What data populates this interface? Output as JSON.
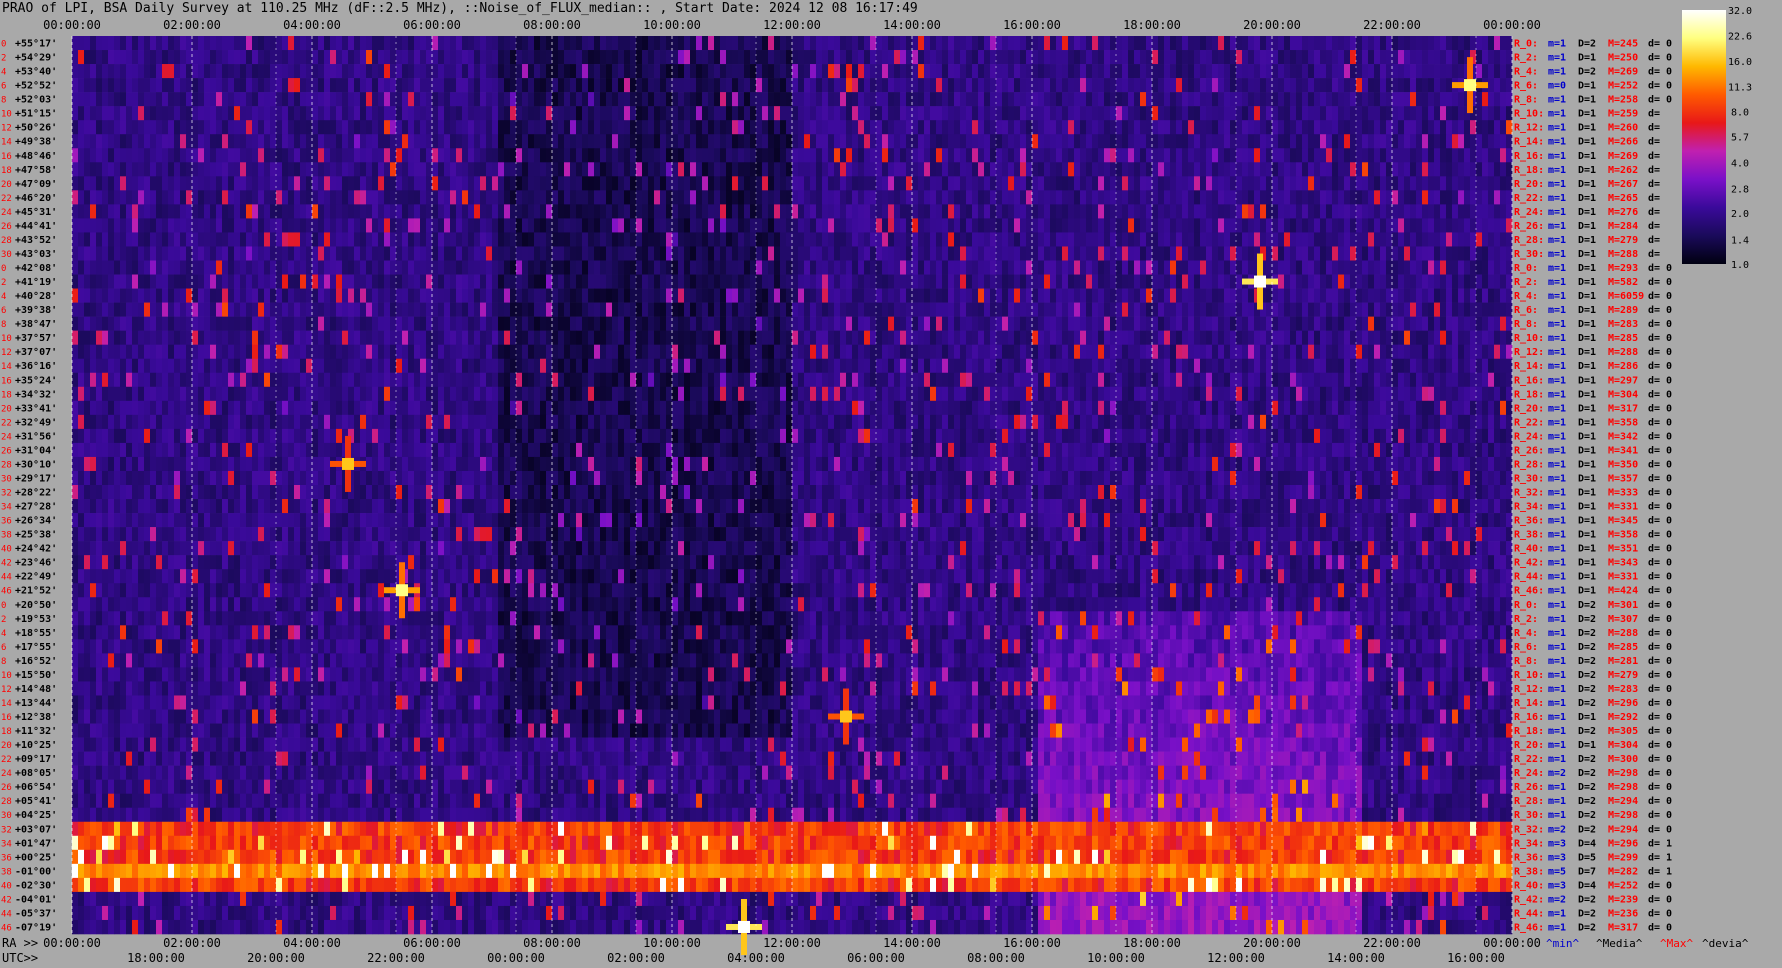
{
  "chart_data": {
    "type": "heatmap",
    "title": "PRAO of LPI, BSA Daily Survey at 110.25 MHz (dF::2.5 MHz), ::Noise_of_FLUX_median:: , Start Date: 2024 12 08 16:17:49",
    "top_time_ticks": [
      "00:00:00",
      "02:00:00",
      "04:00:00",
      "06:00:00",
      "08:00:00",
      "10:00:00",
      "12:00:00",
      "14:00:00",
      "16:00:00",
      "18:00:00",
      "20:00:00",
      "22:00:00",
      "00:00:00"
    ],
    "ra_label": "RA >>",
    "ra_ticks": [
      "00:00:00",
      "02:00:00",
      "04:00:00",
      "06:00:00",
      "08:00:00",
      "10:00:00",
      "12:00:00",
      "14:00:00",
      "16:00:00",
      "18:00:00",
      "20:00:00",
      "22:00:00",
      "00:00:00"
    ],
    "utc_label": "UTC>>",
    "utc_ticks": [
      "18:00:00",
      "20:00:00",
      "22:00:00",
      "00:00:00",
      "02:00:00",
      "04:00:00",
      "06:00:00",
      "08:00:00",
      "10:00:00",
      "12:00:00",
      "14:00:00",
      "16:00:00"
    ],
    "declinations": [
      "+55°17'",
      "+54°29'",
      "+53°40'",
      "+52°52'",
      "+52°03'",
      "+51°15'",
      "+50°26'",
      "+49°38'",
      "+48°46'",
      "+47°58'",
      "+47°09'",
      "+46°20'",
      "+45°31'",
      "+44°41'",
      "+43°52'",
      "+43°03'",
      "+42°08'",
      "+41°19'",
      "+40°28'",
      "+39°38'",
      "+38°47'",
      "+37°57'",
      "+37°07'",
      "+36°16'",
      "+35°24'",
      "+34°32'",
      "+33°41'",
      "+32°49'",
      "+31°56'",
      "+31°04'",
      "+30°10'",
      "+29°17'",
      "+28°22'",
      "+27°28'",
      "+26°34'",
      "+25°38'",
      "+24°42'",
      "+23°46'",
      "+22°49'",
      "+21°52'",
      "+20°50'",
      "+19°53'",
      "+18°55'",
      "+17°55'",
      "+16°52'",
      "+15°50'",
      "+14°48'",
      "+13°44'",
      "+12°38'",
      "+11°32'",
      "+10°25'",
      "+09°17'",
      "+08°05'",
      "+06°54'",
      "+05°41'",
      "+04°25'",
      "+03°07'",
      "+01°47'",
      "+00°25'",
      "-01°00'",
      "-02°30'",
      "-04°01'",
      "-05°37'",
      "-07°19'"
    ],
    "row_index": [
      "0",
      "2",
      "4",
      "6",
      "8",
      "10",
      "12",
      "14",
      "16",
      "18",
      "20",
      "22",
      "24",
      "26",
      "28",
      "30",
      "0",
      "2",
      "4",
      "6",
      "8",
      "10",
      "12",
      "14",
      "16",
      "18",
      "20",
      "22",
      "24",
      "26",
      "28",
      "30",
      "32",
      "34",
      "36",
      "38",
      "40",
      "42",
      "44",
      "46",
      "0",
      "2",
      "4",
      "6",
      "8",
      "10",
      "12",
      "14",
      "16",
      "18",
      "20",
      "22",
      "24",
      "26",
      "28",
      "30",
      "32",
      "34",
      "36",
      "38",
      "40",
      "42",
      "44",
      "46"
    ],
    "stats": [
      {
        "r": "R_0:",
        "m": "m=1",
        "d": "D=2",
        "mx": "M=245",
        "dv": "d= 0"
      },
      {
        "r": "R_2:",
        "m": "m=1",
        "d": "D=1",
        "mx": "M=250",
        "dv": "d= 0"
      },
      {
        "r": "R_4:",
        "m": "m=1",
        "d": "D=2",
        "mx": "M=269",
        "dv": "d= 0"
      },
      {
        "r": "R_6:",
        "m": "m=0",
        "d": "D=1",
        "mx": "M=252",
        "dv": "d= 0"
      },
      {
        "r": "R_8:",
        "m": "m=1",
        "d": "D=1",
        "mx": "M=258",
        "dv": "d= 0"
      },
      {
        "r": "R_10:",
        "m": "m=1",
        "d": "D=1",
        "mx": "M=259",
        "dv": "d="
      },
      {
        "r": "R_12:",
        "m": "m=1",
        "d": "D=1",
        "mx": "M=260",
        "dv": "d="
      },
      {
        "r": "R_14:",
        "m": "m=1",
        "d": "D=1",
        "mx": "M=266",
        "dv": "d="
      },
      {
        "r": "R_16:",
        "m": "m=1",
        "d": "D=1",
        "mx": "M=269",
        "dv": "d="
      },
      {
        "r": "R_18:",
        "m": "m=1",
        "d": "D=1",
        "mx": "M=262",
        "dv": "d="
      },
      {
        "r": "R_20:",
        "m": "m=1",
        "d": "D=1",
        "mx": "M=267",
        "dv": "d="
      },
      {
        "r": "R_22:",
        "m": "m=1",
        "d": "D=1",
        "mx": "M=265",
        "dv": "d="
      },
      {
        "r": "R_24:",
        "m": "m=1",
        "d": "D=1",
        "mx": "M=276",
        "dv": "d="
      },
      {
        "r": "R_26:",
        "m": "m=1",
        "d": "D=1",
        "mx": "M=284",
        "dv": "d="
      },
      {
        "r": "R_28:",
        "m": "m=1",
        "d": "D=1",
        "mx": "M=279",
        "dv": "d="
      },
      {
        "r": "R_30:",
        "m": "m=1",
        "d": "D=1",
        "mx": "M=288",
        "dv": "d="
      },
      {
        "r": "R_0:",
        "m": "m=1",
        "d": "D=1",
        "mx": "M=293",
        "dv": "d= 0"
      },
      {
        "r": "R_2:",
        "m": "m=1",
        "d": "D=1",
        "mx": "M=582",
        "dv": "d= 0"
      },
      {
        "r": "R_4:",
        "m": "m=1",
        "d": "D=1",
        "mx": "M=6059",
        "dv": "d= 0"
      },
      {
        "r": "R_6:",
        "m": "m=1",
        "d": "D=1",
        "mx": "M=289",
        "dv": "d= 0"
      },
      {
        "r": "R_8:",
        "m": "m=1",
        "d": "D=1",
        "mx": "M=283",
        "dv": "d= 0"
      },
      {
        "r": "R_10:",
        "m": "m=1",
        "d": "D=1",
        "mx": "M=285",
        "dv": "d= 0"
      },
      {
        "r": "R_12:",
        "m": "m=1",
        "d": "D=1",
        "mx": "M=288",
        "dv": "d= 0"
      },
      {
        "r": "R_14:",
        "m": "m=1",
        "d": "D=1",
        "mx": "M=286",
        "dv": "d= 0"
      },
      {
        "r": "R_16:",
        "m": "m=1",
        "d": "D=1",
        "mx": "M=297",
        "dv": "d= 0"
      },
      {
        "r": "R_18:",
        "m": "m=1",
        "d": "D=1",
        "mx": "M=304",
        "dv": "d= 0"
      },
      {
        "r": "R_20:",
        "m": "m=1",
        "d": "D=1",
        "mx": "M=317",
        "dv": "d= 0"
      },
      {
        "r": "R_22:",
        "m": "m=1",
        "d": "D=1",
        "mx": "M=358",
        "dv": "d= 0"
      },
      {
        "r": "R_24:",
        "m": "m=1",
        "d": "D=1",
        "mx": "M=342",
        "dv": "d= 0"
      },
      {
        "r": "R_26:",
        "m": "m=1",
        "d": "D=1",
        "mx": "M=341",
        "dv": "d= 0"
      },
      {
        "r": "R_28:",
        "m": "m=1",
        "d": "D=1",
        "mx": "M=350",
        "dv": "d= 0"
      },
      {
        "r": "R_30:",
        "m": "m=1",
        "d": "D=1",
        "mx": "M=357",
        "dv": "d= 0"
      },
      {
        "r": "R_32:",
        "m": "m=1",
        "d": "D=1",
        "mx": "M=333",
        "dv": "d= 0"
      },
      {
        "r": "R_34:",
        "m": "m=1",
        "d": "D=1",
        "mx": "M=331",
        "dv": "d= 0"
      },
      {
        "r": "R_36:",
        "m": "m=1",
        "d": "D=1",
        "mx": "M=345",
        "dv": "d= 0"
      },
      {
        "r": "R_38:",
        "m": "m=1",
        "d": "D=1",
        "mx": "M=358",
        "dv": "d= 0"
      },
      {
        "r": "R_40:",
        "m": "m=1",
        "d": "D=1",
        "mx": "M=351",
        "dv": "d= 0"
      },
      {
        "r": "R_42:",
        "m": "m=1",
        "d": "D=1",
        "mx": "M=343",
        "dv": "d= 0"
      },
      {
        "r": "R_44:",
        "m": "m=1",
        "d": "D=1",
        "mx": "M=331",
        "dv": "d= 0"
      },
      {
        "r": "R_46:",
        "m": "m=1",
        "d": "D=1",
        "mx": "M=424",
        "dv": "d= 0"
      },
      {
        "r": "R_0:",
        "m": "m=1",
        "d": "D=2",
        "mx": "M=301",
        "dv": "d= 0"
      },
      {
        "r": "R_2:",
        "m": "m=1",
        "d": "D=2",
        "mx": "M=307",
        "dv": "d= 0"
      },
      {
        "r": "R_4:",
        "m": "m=1",
        "d": "D=2",
        "mx": "M=288",
        "dv": "d= 0"
      },
      {
        "r": "R_6:",
        "m": "m=1",
        "d": "D=2",
        "mx": "M=285",
        "dv": "d= 0"
      },
      {
        "r": "R_8:",
        "m": "m=1",
        "d": "D=2",
        "mx": "M=281",
        "dv": "d= 0"
      },
      {
        "r": "R_10:",
        "m": "m=1",
        "d": "D=2",
        "mx": "M=279",
        "dv": "d= 0"
      },
      {
        "r": "R_12:",
        "m": "m=1",
        "d": "D=2",
        "mx": "M=283",
        "dv": "d= 0"
      },
      {
        "r": "R_14:",
        "m": "m=1",
        "d": "D=2",
        "mx": "M=296",
        "dv": "d= 0"
      },
      {
        "r": "R_16:",
        "m": "m=1",
        "d": "D=1",
        "mx": "M=292",
        "dv": "d= 0"
      },
      {
        "r": "R_18:",
        "m": "m=1",
        "d": "D=2",
        "mx": "M=305",
        "dv": "d= 0"
      },
      {
        "r": "R_20:",
        "m": "m=1",
        "d": "D=1",
        "mx": "M=304",
        "dv": "d= 0"
      },
      {
        "r": "R_22:",
        "m": "m=1",
        "d": "D=2",
        "mx": "M=300",
        "dv": "d= 0"
      },
      {
        "r": "R_24:",
        "m": "m=2",
        "d": "D=2",
        "mx": "M=298",
        "dv": "d= 0"
      },
      {
        "r": "R_26:",
        "m": "m=1",
        "d": "D=2",
        "mx": "M=298",
        "dv": "d= 0"
      },
      {
        "r": "R_28:",
        "m": "m=1",
        "d": "D=2",
        "mx": "M=294",
        "dv": "d= 0"
      },
      {
        "r": "R_30:",
        "m": "m=1",
        "d": "D=2",
        "mx": "M=298",
        "dv": "d= 0"
      },
      {
        "r": "R_32:",
        "m": "m=2",
        "d": "D=2",
        "mx": "M=294",
        "dv": "d= 0"
      },
      {
        "r": "R_34:",
        "m": "m=3",
        "d": "D=4",
        "mx": "M=296",
        "dv": "d= 1"
      },
      {
        "r": "R_36:",
        "m": "m=3",
        "d": "D=5",
        "mx": "M=299",
        "dv": "d= 1"
      },
      {
        "r": "R_38:",
        "m": "m=5",
        "d": "D=7",
        "mx": "M=282",
        "dv": "d= 1"
      },
      {
        "r": "R_40:",
        "m": "m=3",
        "d": "D=4",
        "mx": "M=252",
        "dv": "d= 0"
      },
      {
        "r": "R_42:",
        "m": "m=2",
        "d": "D=2",
        "mx": "M=239",
        "dv": "d= 0"
      },
      {
        "r": "R_44:",
        "m": "m=1",
        "d": "D=2",
        "mx": "M=236",
        "dv": "d= 0"
      },
      {
        "r": "R_46:",
        "m": "m=1",
        "d": "D=2",
        "mx": "M=317",
        "dv": "d= 0"
      }
    ],
    "footer_labels": [
      "^min^",
      "^Media^",
      "^Max^",
      "^devia^"
    ],
    "colorbar_ticks": [
      "32.0",
      "22.6",
      "16.0",
      "11.3",
      "8.0",
      "5.7",
      "4.0",
      "2.8",
      "2.0",
      "1.4",
      "1.0"
    ],
    "colorbar_range": [
      1.0,
      32.0
    ],
    "colorbar_scale": "log",
    "colorbar_stops": [
      "#000010",
      "#1a0a5a",
      "#3a0a9a",
      "#7a10c8",
      "#c020b0",
      "#e81818",
      "#ff5a00",
      "#ffb800",
      "#ffff80",
      "#ffffff"
    ],
    "label_colors": {
      "red": "#ff0000",
      "blue": "#0000cc",
      "black": "#000000"
    },
    "features": {
      "equatorial_band_rows": [
        56,
        60
      ],
      "grid_on": true,
      "bright_sources": [
        {
          "ra_h": 19.8,
          "dec_row": 17,
          "level": 32
        },
        {
          "ra_h": 5.5,
          "dec_row": 39,
          "level": 22
        },
        {
          "ra_h": 4.6,
          "dec_row": 30,
          "level": 16
        },
        {
          "ra_h": 11.2,
          "dec_row": 63,
          "level": 32
        },
        {
          "ra_h": 12.9,
          "dec_row": 48,
          "level": 16
        },
        {
          "ra_h": 23.3,
          "dec_row": 3,
          "level": 22
        }
      ]
    }
  }
}
